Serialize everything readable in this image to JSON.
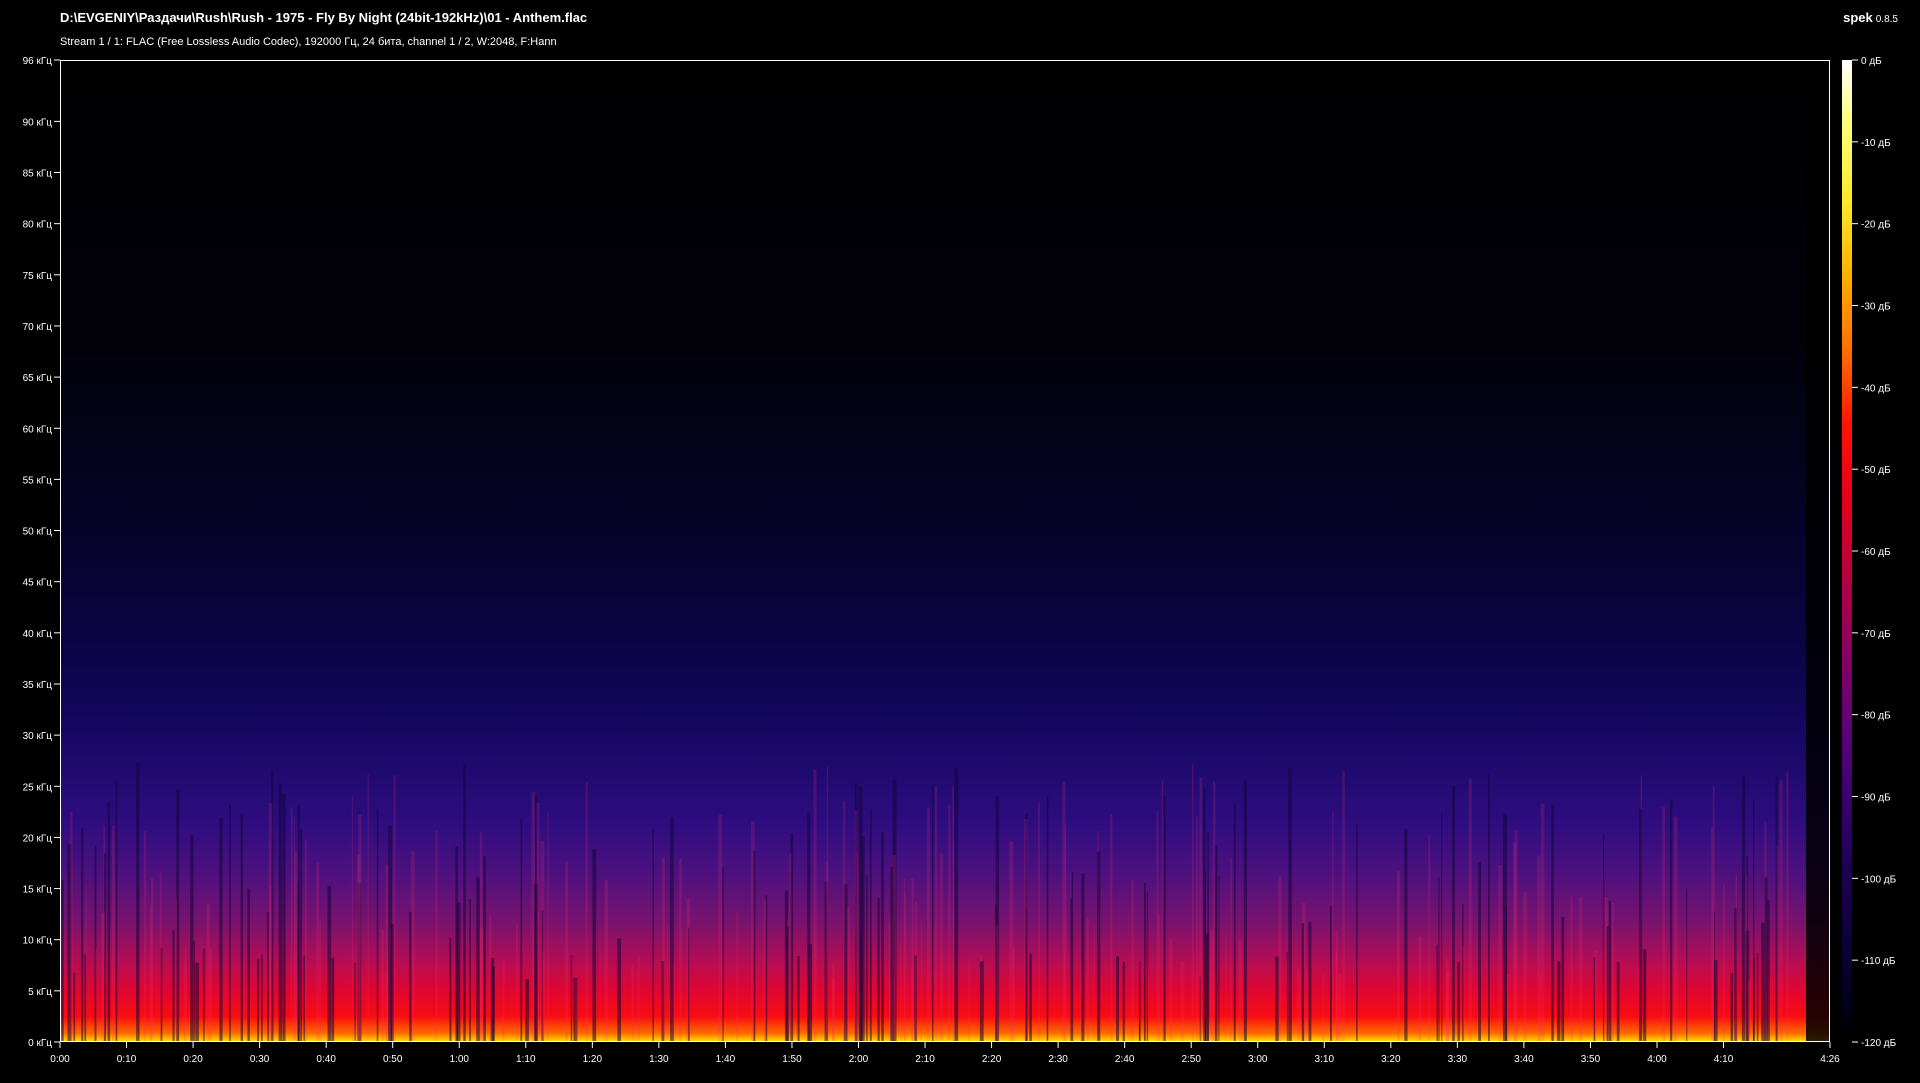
{
  "window": {
    "file_title": "D:\\EVGENIY\\Раздачи\\Rush\\Rush - 1975 - Fly By Night (24bit-192kHz)\\01 - Anthem.flac",
    "stream_info": "Stream 1 / 1: FLAC (Free Lossless Audio Codec), 192000 Гц, 24 бита, channel 1 / 2, W:2048, F:Hann",
    "app_name": "spek",
    "app_version": "0.8.5"
  },
  "chart_data": {
    "type": "heatmap",
    "title": "",
    "y_axis": {
      "unit": "kHz",
      "range": [
        0,
        96
      ],
      "ticks": [
        0,
        5,
        10,
        15,
        20,
        25,
        30,
        35,
        40,
        45,
        50,
        55,
        60,
        65,
        70,
        75,
        80,
        85,
        90,
        96
      ],
      "tick_labels": [
        "0 кГц",
        "5 кГц",
        "10 кГц",
        "15 кГц",
        "20 кГц",
        "25 кГц",
        "30 кГц",
        "35 кГц",
        "40 кГц",
        "45 кГц",
        "50 кГц",
        "55 кГц",
        "60 кГц",
        "65 кГц",
        "70 кГц",
        "75 кГц",
        "80 кГц",
        "85 кГц",
        "90 кГц",
        "96 кГц"
      ]
    },
    "x_axis": {
      "unit": "seconds",
      "range": [
        0,
        266
      ],
      "ticks": [
        0,
        10,
        20,
        30,
        40,
        50,
        60,
        70,
        80,
        90,
        100,
        110,
        120,
        130,
        140,
        150,
        160,
        170,
        180,
        190,
        200,
        210,
        220,
        230,
        240,
        250,
        266
      ],
      "tick_labels": [
        "0:00",
        "0:10",
        "0:20",
        "0:30",
        "0:40",
        "0:50",
        "1:00",
        "1:10",
        "1:20",
        "1:30",
        "1:40",
        "1:50",
        "2:00",
        "2:10",
        "2:20",
        "2:30",
        "2:40",
        "2:50",
        "3:00",
        "3:10",
        "3:20",
        "3:30",
        "3:40",
        "3:50",
        "4:00",
        "4:10",
        "4:26"
      ]
    },
    "color_scale": {
      "unit": "dB",
      "range": [
        -120,
        0
      ],
      "ticks": [
        0,
        -10,
        -20,
        -30,
        -40,
        -50,
        -60,
        -70,
        -80,
        -90,
        -100,
        -110,
        -120
      ],
      "tick_labels": [
        "0 дБ",
        "-10 дБ",
        "-20 дБ",
        "-30 дБ",
        "-40 дБ",
        "-50 дБ",
        "-60 дБ",
        "-70 дБ",
        "-80 дБ",
        "-90 дБ",
        "-100 дБ",
        "-110 дБ",
        "-120 дБ"
      ],
      "colors": [
        "#ffffff",
        "#ffeb2a",
        "#ff6a00",
        "#e8001a",
        "#8a0060",
        "#3a006e",
        "#0c0038",
        "#000000"
      ]
    },
    "energy_profile": [
      {
        "freq_khz": 1,
        "level_db": -38
      },
      {
        "freq_khz": 5,
        "level_db": -50
      },
      {
        "freq_khz": 15,
        "level_db": -78
      },
      {
        "freq_khz": 20,
        "level_db": -90
      },
      {
        "freq_khz": 35,
        "level_db": -100
      },
      {
        "freq_khz": 50,
        "level_db": -108
      },
      {
        "freq_khz": 70,
        "level_db": -115
      },
      {
        "freq_khz": 96,
        "level_db": -120
      }
    ]
  }
}
